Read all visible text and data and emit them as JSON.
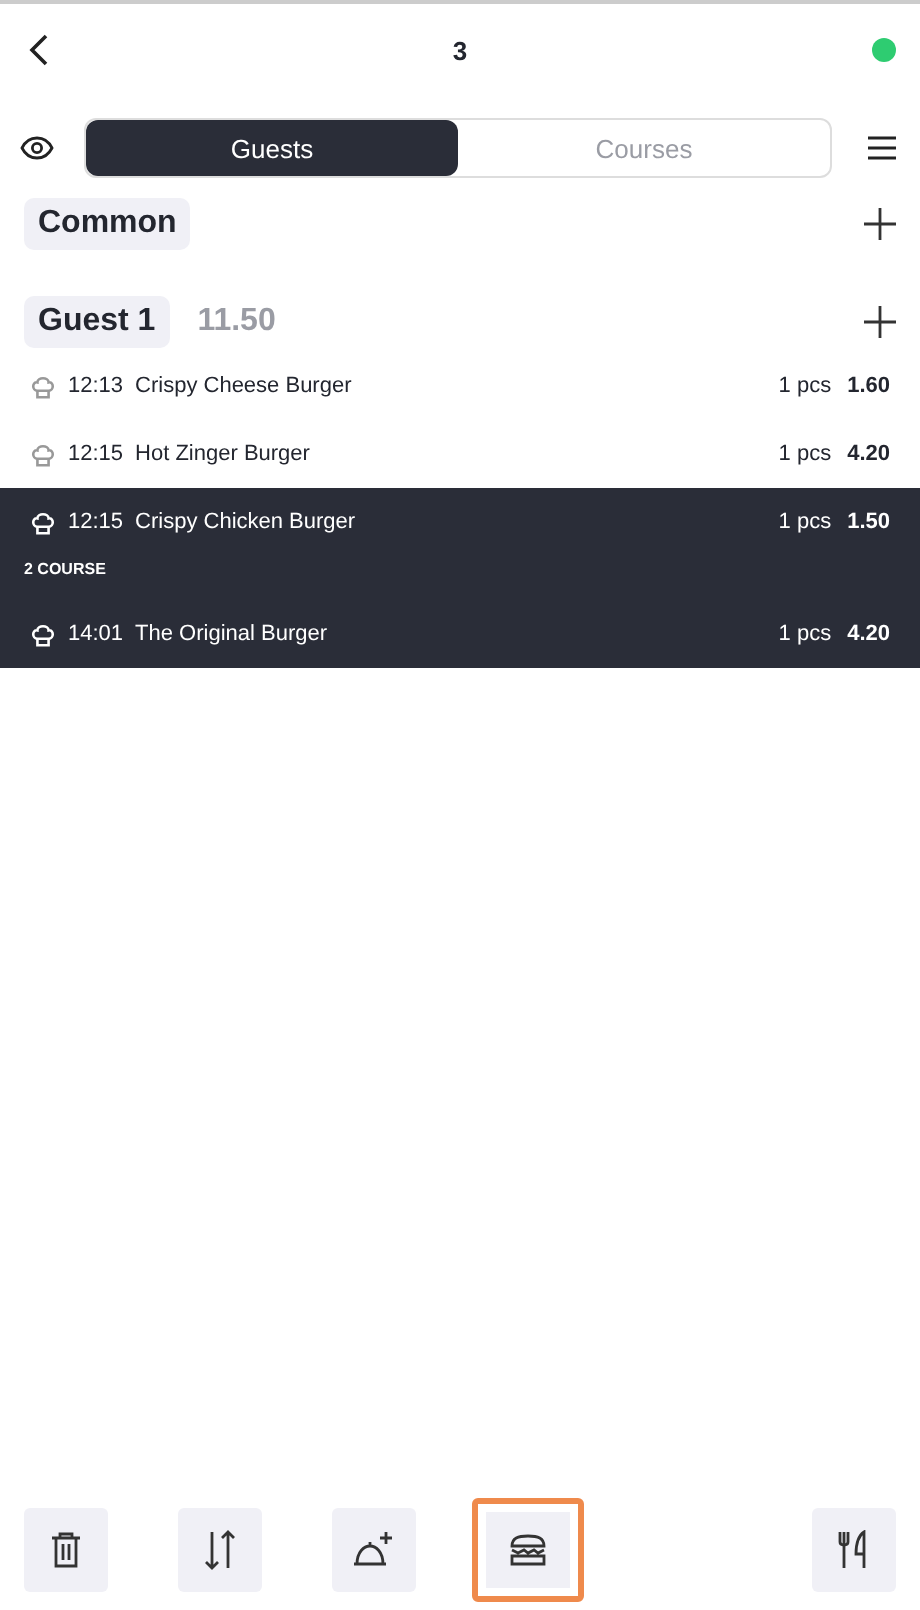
{
  "header": {
    "title": "3",
    "online": true
  },
  "view_tabs": [
    {
      "label": "Guests",
      "selected": true
    },
    {
      "label": "Courses",
      "selected": false
    }
  ],
  "common": {
    "label": "Common"
  },
  "guest": {
    "label": "Guest 1",
    "total": "11.50"
  },
  "rows": [
    {
      "kind": "item",
      "time": "12:13",
      "name": "Crispy Cheese Burger",
      "qty": "1 pcs",
      "price": "1.60",
      "selected": false
    },
    {
      "kind": "item",
      "time": "12:15",
      "name": "Hot Zinger Burger",
      "qty": "1 pcs",
      "price": "4.20",
      "selected": false
    },
    {
      "kind": "item",
      "time": "12:15",
      "name": "Crispy Chicken Burger",
      "qty": "1 pcs",
      "price": "1.50",
      "selected": true
    },
    {
      "kind": "course",
      "label": "2 COURSE",
      "selected": true
    },
    {
      "kind": "item",
      "time": "14:01",
      "name": "The Original Burger",
      "qty": "1 pcs",
      "price": "4.20",
      "selected": true
    }
  ],
  "toolbar": [
    {
      "kind": "delete",
      "highlighted": false
    },
    {
      "kind": "sort",
      "highlighted": false
    },
    {
      "kind": "serve",
      "highlighted": false
    },
    {
      "kind": "burger",
      "highlighted": true
    },
    {
      "kind": "spacer"
    },
    {
      "kind": "cutlery",
      "highlighted": false
    }
  ]
}
